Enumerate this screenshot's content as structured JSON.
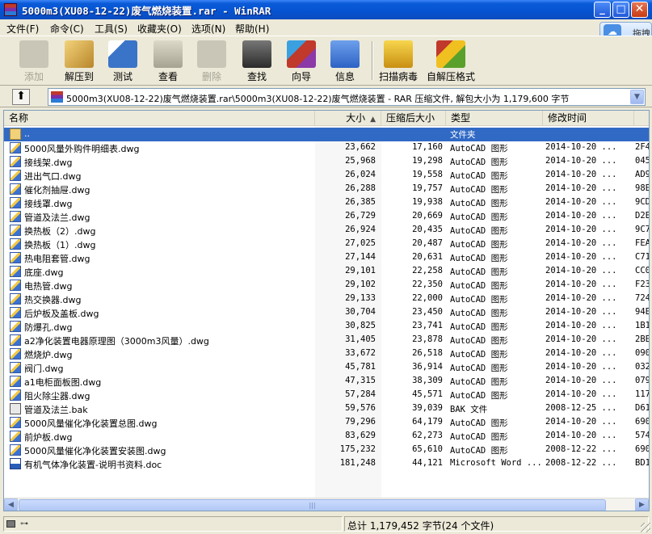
{
  "window": {
    "title": "5000m3(XU08-12-22)废气燃烧装置.rar - WinRAR",
    "min_glyph": "_",
    "max_glyph": "□",
    "close_glyph": "✕"
  },
  "menu": [
    {
      "label": "文件(F)"
    },
    {
      "label": "命令(C)"
    },
    {
      "label": "工具(S)"
    },
    {
      "label": "收藏夹(O)"
    },
    {
      "label": "选项(N)"
    },
    {
      "label": "帮助(H)"
    }
  ],
  "floating_widget": {
    "label": "拖拽",
    "icon": "cloud-icon"
  },
  "toolbar": [
    {
      "label": "添加",
      "enabled": false,
      "icon": "add-icon",
      "color": "#b4b1a5"
    },
    {
      "label": "解压到",
      "enabled": true,
      "icon": "extract-to-icon",
      "color": "#d8a640"
    },
    {
      "label": "测试",
      "enabled": true,
      "icon": "test-icon",
      "color": "#3a74c9"
    },
    {
      "label": "查看",
      "enabled": true,
      "icon": "view-icon",
      "color": "#c9c6b4"
    },
    {
      "label": "删除",
      "enabled": false,
      "icon": "delete-icon",
      "color": "#b4b1a5"
    },
    {
      "label": "查找",
      "enabled": true,
      "icon": "find-icon",
      "color": "#4a4a4a"
    },
    {
      "label": "向导",
      "enabled": true,
      "icon": "wizard-icon",
      "color": "#8b3aa8"
    },
    {
      "label": "信息",
      "enabled": true,
      "icon": "info-icon",
      "color": "#2d62c4"
    },
    {
      "label": "扫描病毒",
      "enabled": true,
      "icon": "virus-scan-icon",
      "color": "#e0b020"
    },
    {
      "label": "自解压格式",
      "enabled": true,
      "icon": "sfx-icon",
      "color": "#5aa02c"
    }
  ],
  "address": {
    "up_glyph": "⬆",
    "path": "5000m3(XU08-12-22)废气燃烧装置.rar\\5000m3(XU08-12-22)废气燃烧装置 - RAR 压缩文件, 解包大小为 1,179,600 字节",
    "drop_glyph": "▼"
  },
  "columns": {
    "name": "名称",
    "size": "大小",
    "packed": "压缩后大小",
    "type": "类型",
    "mtime": "修改时间",
    "sort_glyph": "▲"
  },
  "rows": [
    {
      "name": "..",
      "size": "",
      "packed": "",
      "type": "文件夹",
      "mtime": "",
      "crc": "",
      "kind": "folder",
      "selected": true
    },
    {
      "name": "5000风量外购件明细表.dwg",
      "size": "23,662",
      "packed": "17,160",
      "type": "AutoCAD 图形",
      "mtime": "2014-10-20 ...",
      "crc": "2F4",
      "kind": "dwg"
    },
    {
      "name": "接线架.dwg",
      "size": "25,968",
      "packed": "19,298",
      "type": "AutoCAD 图形",
      "mtime": "2014-10-20 ...",
      "crc": "045",
      "kind": "dwg"
    },
    {
      "name": "进出气口.dwg",
      "size": "26,024",
      "packed": "19,558",
      "type": "AutoCAD 图形",
      "mtime": "2014-10-20 ...",
      "crc": "AD9",
      "kind": "dwg"
    },
    {
      "name": "催化剂抽屉.dwg",
      "size": "26,288",
      "packed": "19,757",
      "type": "AutoCAD 图形",
      "mtime": "2014-10-20 ...",
      "crc": "98E",
      "kind": "dwg"
    },
    {
      "name": "接线罩.dwg",
      "size": "26,385",
      "packed": "19,938",
      "type": "AutoCAD 图形",
      "mtime": "2014-10-20 ...",
      "crc": "9CD",
      "kind": "dwg"
    },
    {
      "name": "管道及法兰.dwg",
      "size": "26,729",
      "packed": "20,669",
      "type": "AutoCAD 图形",
      "mtime": "2014-10-20 ...",
      "crc": "D2E",
      "kind": "dwg"
    },
    {
      "name": "换热板（2）.dwg",
      "size": "26,924",
      "packed": "20,435",
      "type": "AutoCAD 图形",
      "mtime": "2014-10-20 ...",
      "crc": "9C7",
      "kind": "dwg"
    },
    {
      "name": "换热板（1）.dwg",
      "size": "27,025",
      "packed": "20,487",
      "type": "AutoCAD 图形",
      "mtime": "2014-10-20 ...",
      "crc": "FEA",
      "kind": "dwg"
    },
    {
      "name": "热电阻套管.dwg",
      "size": "27,144",
      "packed": "20,631",
      "type": "AutoCAD 图形",
      "mtime": "2014-10-20 ...",
      "crc": "C71",
      "kind": "dwg"
    },
    {
      "name": "底座.dwg",
      "size": "29,101",
      "packed": "22,258",
      "type": "AutoCAD 图形",
      "mtime": "2014-10-20 ...",
      "crc": "CC0",
      "kind": "dwg"
    },
    {
      "name": "电热管.dwg",
      "size": "29,102",
      "packed": "22,350",
      "type": "AutoCAD 图形",
      "mtime": "2014-10-20 ...",
      "crc": "F23",
      "kind": "dwg"
    },
    {
      "name": "热交换器.dwg",
      "size": "29,133",
      "packed": "22,000",
      "type": "AutoCAD 图形",
      "mtime": "2014-10-20 ...",
      "crc": "724",
      "kind": "dwg"
    },
    {
      "name": "后炉板及盖板.dwg",
      "size": "30,704",
      "packed": "23,450",
      "type": "AutoCAD 图形",
      "mtime": "2014-10-20 ...",
      "crc": "94E",
      "kind": "dwg"
    },
    {
      "name": "防爆孔.dwg",
      "size": "30,825",
      "packed": "23,741",
      "type": "AutoCAD 图形",
      "mtime": "2014-10-20 ...",
      "crc": "1B1",
      "kind": "dwg"
    },
    {
      "name": "a2净化装置电器原理图（3000m3风量）.dwg",
      "size": "31,405",
      "packed": "23,878",
      "type": "AutoCAD 图形",
      "mtime": "2014-10-20 ...",
      "crc": "2BE",
      "kind": "dwg"
    },
    {
      "name": "燃烧炉.dwg",
      "size": "33,672",
      "packed": "26,518",
      "type": "AutoCAD 图形",
      "mtime": "2014-10-20 ...",
      "crc": "090",
      "kind": "dwg"
    },
    {
      "name": "阀门.dwg",
      "size": "45,781",
      "packed": "36,914",
      "type": "AutoCAD 图形",
      "mtime": "2014-10-20 ...",
      "crc": "032",
      "kind": "dwg"
    },
    {
      "name": "a1电柜面板图.dwg",
      "size": "47,315",
      "packed": "38,309",
      "type": "AutoCAD 图形",
      "mtime": "2014-10-20 ...",
      "crc": "079",
      "kind": "dwg"
    },
    {
      "name": "阻火除尘器.dwg",
      "size": "57,284",
      "packed": "45,571",
      "type": "AutoCAD 图形",
      "mtime": "2014-10-20 ...",
      "crc": "117",
      "kind": "dwg"
    },
    {
      "name": "管道及法兰.bak",
      "size": "59,576",
      "packed": "39,039",
      "type": "BAK 文件",
      "mtime": "2008-12-25 ...",
      "crc": "D61",
      "kind": "bak"
    },
    {
      "name": "5000风量催化净化装置总图.dwg",
      "size": "79,296",
      "packed": "64,179",
      "type": "AutoCAD 图形",
      "mtime": "2014-10-20 ...",
      "crc": "690",
      "kind": "dwg"
    },
    {
      "name": "前炉板.dwg",
      "size": "83,629",
      "packed": "62,273",
      "type": "AutoCAD 图形",
      "mtime": "2014-10-20 ...",
      "crc": "574",
      "kind": "dwg"
    },
    {
      "name": "5000风量催化净化装置安装图.dwg",
      "size": "175,232",
      "packed": "65,610",
      "type": "AutoCAD 图形",
      "mtime": "2008-12-22 ...",
      "crc": "690",
      "kind": "dwg"
    },
    {
      "name": "有机气体净化装置-说明书资料.doc",
      "size": "181,248",
      "packed": "44,121",
      "type": "Microsoft Word ...",
      "mtime": "2008-12-22 ...",
      "crc": "BD1",
      "kind": "doc"
    }
  ],
  "scrollbar": {
    "left_glyph": "◀",
    "right_glyph": "▶",
    "thumb_glyph": "|||"
  },
  "status": {
    "summary": "总计 1,179,452 字节(24 个文件)",
    "key_glyph": "⊶"
  }
}
